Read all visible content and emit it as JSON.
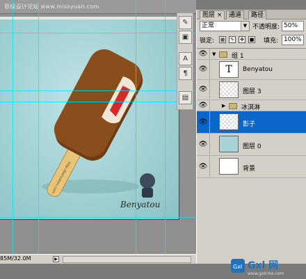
{
  "watermark": "思缘设计论坛 www.missyuan.com",
  "status": {
    "doc_size": "85M/32.0M",
    "arrow": "▶"
  },
  "panel": {
    "tabs": [
      {
        "label": "图层",
        "close": "×"
      },
      {
        "label": "通道"
      },
      {
        "label": "路径"
      }
    ],
    "blend_mode": "正常",
    "opacity_label": "不透明度:",
    "opacity_value": "50%",
    "lock_label": "锁定:",
    "fill_label": "填充:",
    "fill_value": "100%"
  },
  "layers": [
    {
      "name": "组 1",
      "kind": "group-open",
      "visible": true
    },
    {
      "name": "Benyatou",
      "kind": "text",
      "visible": true,
      "thumb_glyph": "T"
    },
    {
      "name": "图层 3",
      "kind": "raster",
      "visible": true
    },
    {
      "name": "冰淇淋",
      "kind": "group-closed",
      "visible": true
    },
    {
      "name": "影子",
      "kind": "raster",
      "visible": true,
      "selected": true
    },
    {
      "name": "图层 0",
      "kind": "raster",
      "visible": true
    },
    {
      "name": "背景",
      "kind": "background",
      "visible": true
    }
  ],
  "canvas": {
    "signature": "Benyatou",
    "stick_text": "http://benyatou.com"
  },
  "logo": {
    "text": "Gxl 网",
    "subtext": "www.gxlcms.com"
  },
  "colors": {
    "selection": "#0a66c8",
    "guide": "#00e6ff",
    "canvas_bg": "#a6d4d6"
  }
}
